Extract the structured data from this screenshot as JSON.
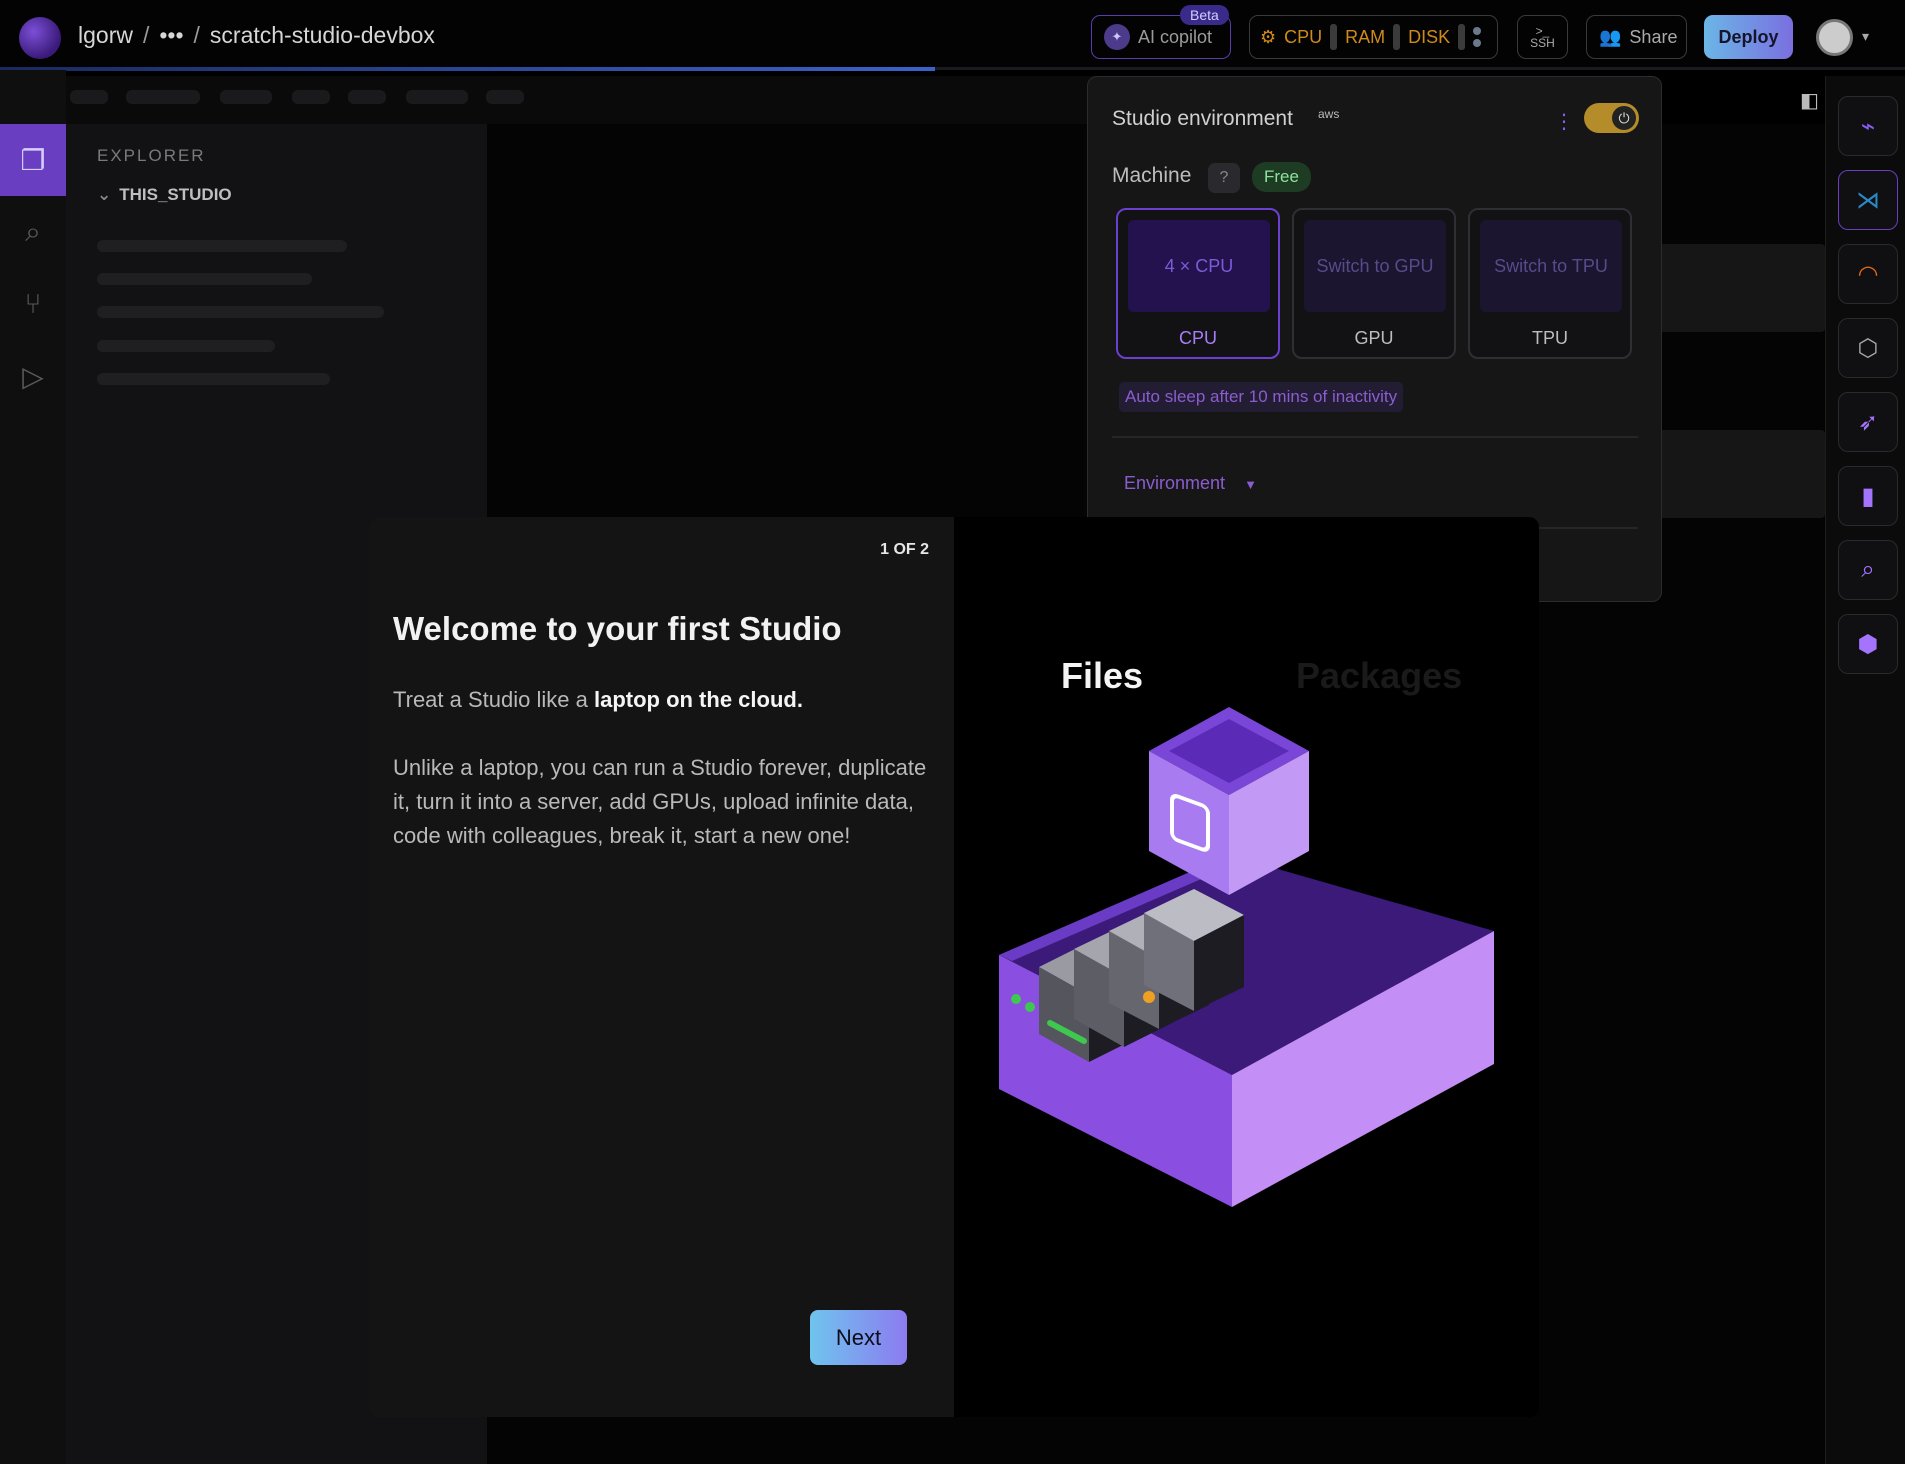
{
  "topbar": {
    "user": "lgorw",
    "ellipsis": "•••",
    "separator": "/",
    "project": "scratch-studio-devbox",
    "copilot_label": "AI copilot",
    "beta_badge": "Beta",
    "res_cpu": "CPU",
    "res_ram": "RAM",
    "res_disk": "DISK",
    "ssh_label": "SSH",
    "share_label": "Share",
    "deploy_label": "Deploy"
  },
  "explorer": {
    "heading": "EXPLORER",
    "root_folder": "THIS_STUDIO"
  },
  "env_panel": {
    "title": "Studio environment",
    "provider": "aws",
    "machine_label": "Machine",
    "help": "?",
    "plan_badge": "Free",
    "machines": [
      {
        "preview": "4 × CPU",
        "label": "CPU",
        "selected": true
      },
      {
        "preview": "Switch to GPU",
        "label": "GPU",
        "selected": false
      },
      {
        "preview": "Switch to TPU",
        "label": "TPU",
        "selected": false
      }
    ],
    "auto_sleep": "Auto sleep after 10 mins of inactivity",
    "environment_label": "Environment"
  },
  "modal": {
    "step": "1 OF 2",
    "title": "Welcome to your first Studio",
    "intro_prefix": "Treat a Studio like a ",
    "intro_bold": "laptop on the cloud.",
    "body": "Unlike a laptop, you can run a Studio forever, duplicate it, turn it into a server, add GPUs, upload infinite data, code with colleagues, break it, start a new one!",
    "next_label": "Next",
    "slide_tab_active": "Files",
    "slide_tab_inactive": "Packages"
  },
  "colors": {
    "accent": "#6a3ec0",
    "deploy_gradient_start": "#6bb6e6",
    "deploy_gradient_end": "#7a6fe0",
    "resource_text": "#d08a1b",
    "free_badge": "#8ee39c"
  }
}
